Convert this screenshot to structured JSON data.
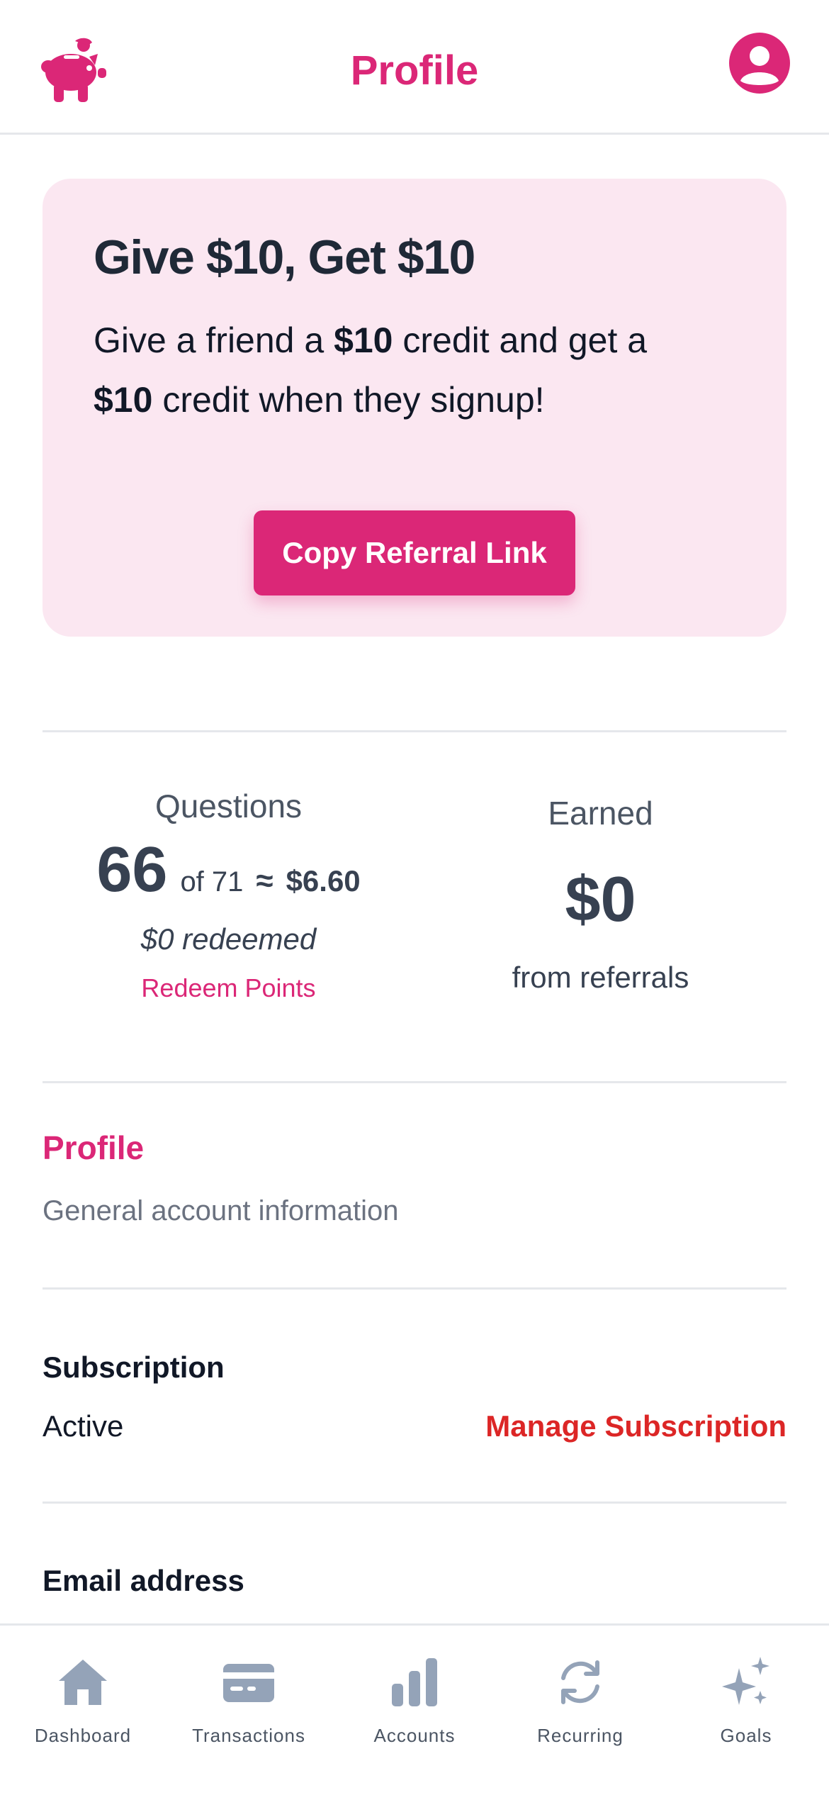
{
  "header": {
    "title": "Profile",
    "logo_icon": "piggy-bank-icon",
    "avatar_icon": "user-circle-icon"
  },
  "colors": {
    "accent": "#db2777",
    "card_bg": "#fbe7f1",
    "danger": "#dc2626",
    "nav_icon": "#94a3b8"
  },
  "referral": {
    "heading": "Give $10, Get $10",
    "text_1": "Give a friend a ",
    "amount_1": "$10",
    "text_2": " credit and get a ",
    "amount_2": "$10",
    "text_3": " credit when they signup!",
    "button_label": "Copy Referral Link"
  },
  "stats": {
    "questions": {
      "label": "Questions",
      "count": "66",
      "of_total": "of 71",
      "approx": "≈",
      "value": "$6.60",
      "redeemed": "$0 redeemed",
      "redeem_link": "Redeem Points"
    },
    "earned": {
      "label": "Earned",
      "amount": "$0",
      "caption": "from referrals"
    }
  },
  "profile": {
    "title": "Profile",
    "subtitle": "General account information",
    "subscription_label": "Subscription",
    "subscription_status": "Active",
    "manage_link": "Manage Subscription",
    "email_label": "Email address"
  },
  "nav": [
    {
      "label": "Dashboard",
      "icon": "home-icon"
    },
    {
      "label": "Transactions",
      "icon": "credit-card-icon"
    },
    {
      "label": "Accounts",
      "icon": "bar-chart-icon"
    },
    {
      "label": "Recurring",
      "icon": "refresh-icon"
    },
    {
      "label": "Goals",
      "icon": "sparkles-icon"
    }
  ]
}
